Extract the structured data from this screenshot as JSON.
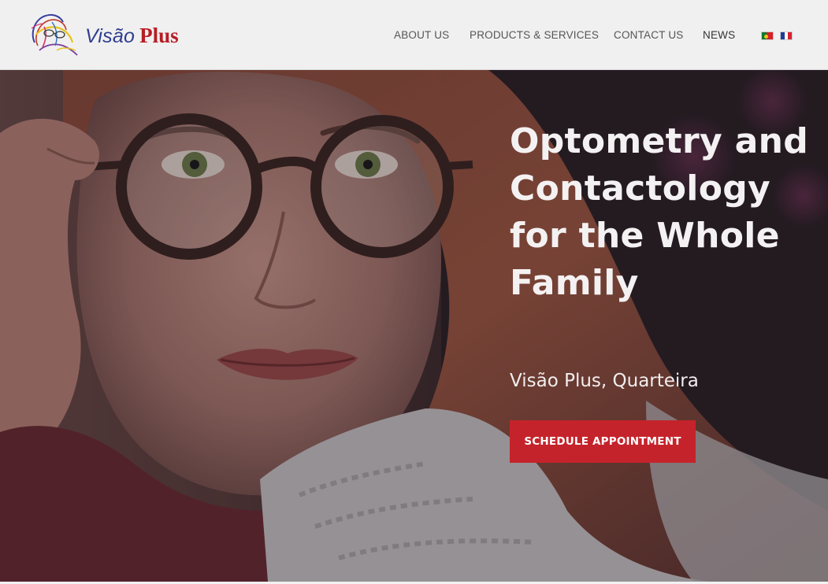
{
  "brand": {
    "name_part1": "Visão",
    "name_part2": "Plus"
  },
  "nav": {
    "items": [
      {
        "label": "ABOUT US"
      },
      {
        "label": "PRODUCTS & SERVICES"
      },
      {
        "label": "CONTACT US"
      },
      {
        "label": "NEWS"
      }
    ],
    "languages": [
      {
        "icon": "flag-portugal-icon"
      },
      {
        "icon": "flag-france-icon"
      }
    ]
  },
  "hero": {
    "title": "Optometry and Contactology for the Whole Family",
    "subtitle": "Visão Plus, Quarteira",
    "cta_label": "SCHEDULE APPOINTMENT"
  },
  "colors": {
    "header_bg": "#f0f0f0",
    "nav_text": "#555555",
    "brand_blue": "#2f3d8f",
    "brand_red": "#b81d24",
    "cta_bg": "#c5232b",
    "hero_text": "#f4f1f2"
  }
}
